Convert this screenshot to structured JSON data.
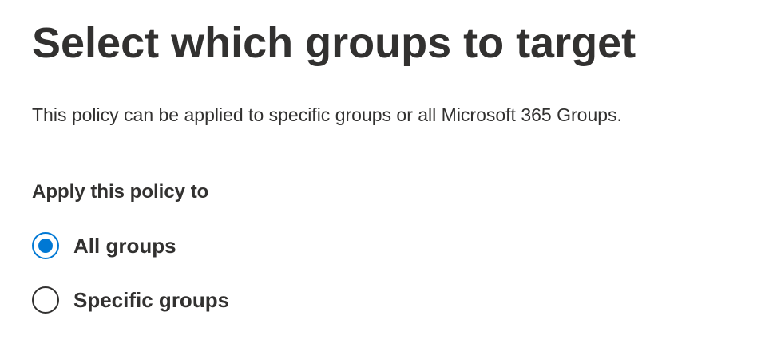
{
  "page": {
    "title": "Select which groups to target",
    "description": "This policy can be applied to specific groups or all Microsoft 365 Groups."
  },
  "apply_policy": {
    "label": "Apply this policy to",
    "options": [
      {
        "label": "All groups",
        "selected": true
      },
      {
        "label": "Specific groups",
        "selected": false
      }
    ],
    "selected_value": "All groups"
  },
  "colors": {
    "accent": "#0078d4",
    "text": "#323130",
    "background": "#ffffff"
  }
}
